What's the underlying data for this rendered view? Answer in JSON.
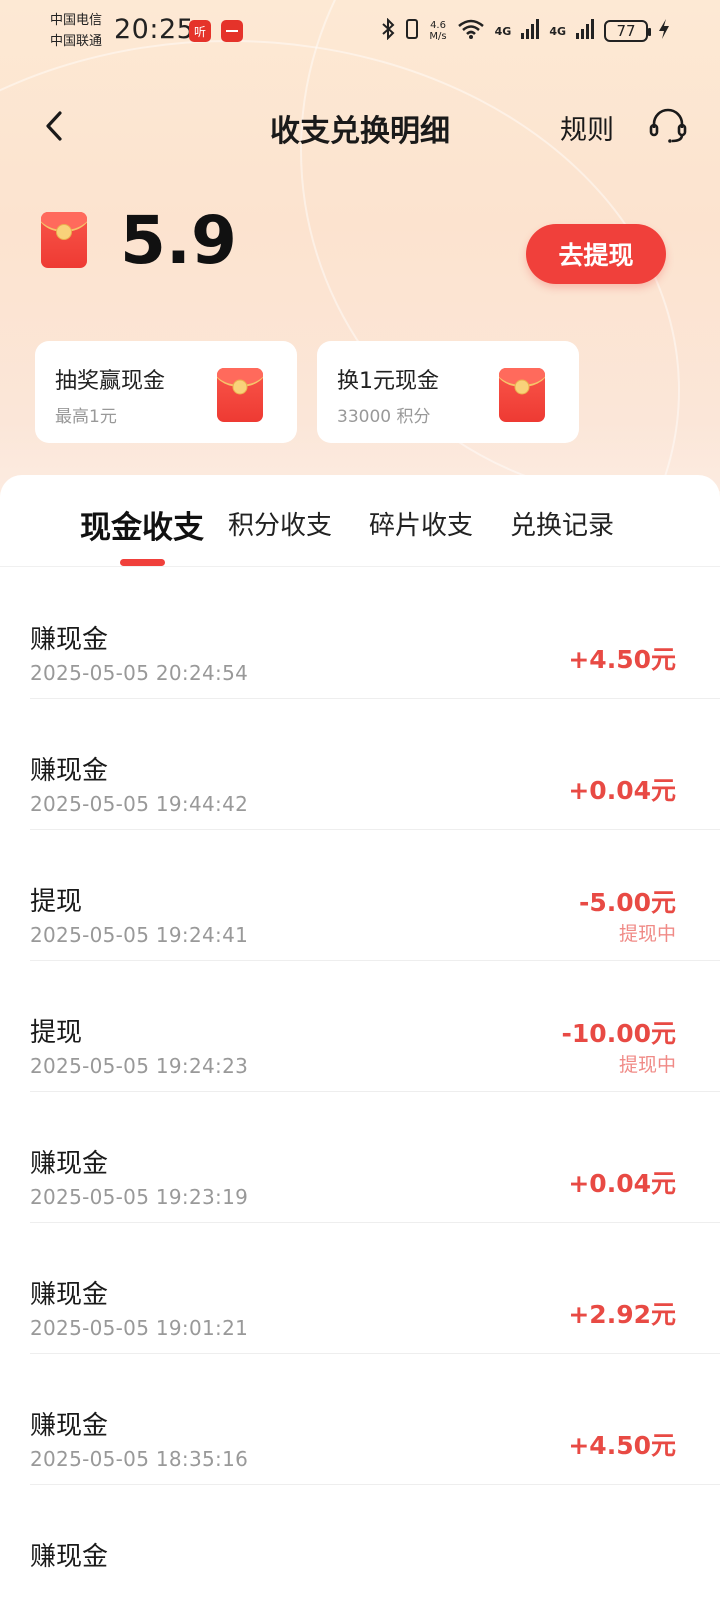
{
  "status_bar": {
    "carrier1": "中国电信",
    "carrier2": "中国联通",
    "time": "20:25",
    "app_badge_1": "听",
    "net_speed_value": "4.6",
    "net_speed_unit": "M/s",
    "signal1": "4G",
    "signal2": "4G",
    "battery": "77"
  },
  "header": {
    "title": "收支兑换明细",
    "rules_label": "规则"
  },
  "balance": {
    "value": "5.9",
    "withdraw_label": "去提现"
  },
  "promos": [
    {
      "title": "抽奖赢现金",
      "subtitle": "最高1元"
    },
    {
      "title": "换1元现金",
      "subtitle": "33000 积分"
    }
  ],
  "tabs": [
    {
      "label": "现金收支",
      "active": true
    },
    {
      "label": "积分收支",
      "active": false
    },
    {
      "label": "碎片收支",
      "active": false
    },
    {
      "label": "兑换记录",
      "active": false
    }
  ],
  "records": [
    {
      "title": "赚现金",
      "time": "2025-05-05 20:24:54",
      "amount": "+4.50元",
      "status": ""
    },
    {
      "title": "赚现金",
      "time": "2025-05-05 19:44:42",
      "amount": "+0.04元",
      "status": ""
    },
    {
      "title": "提现",
      "time": "2025-05-05 19:24:41",
      "amount": "-5.00元",
      "status": "提现中"
    },
    {
      "title": "提现",
      "time": "2025-05-05 19:24:23",
      "amount": "-10.00元",
      "status": "提现中"
    },
    {
      "title": "赚现金",
      "time": "2025-05-05 19:23:19",
      "amount": "+0.04元",
      "status": ""
    },
    {
      "title": "赚现金",
      "time": "2025-05-05 19:01:21",
      "amount": "+2.92元",
      "status": ""
    },
    {
      "title": "赚现金",
      "time": "2025-05-05 18:35:16",
      "amount": "+4.50元",
      "status": ""
    },
    {
      "title": "赚现金",
      "time": "",
      "amount": "",
      "status": ""
    }
  ],
  "colors": {
    "accent": "#f0403b",
    "amount": "#e84a44",
    "pending": "#f08a86",
    "header_bg": "#fde9d4"
  }
}
